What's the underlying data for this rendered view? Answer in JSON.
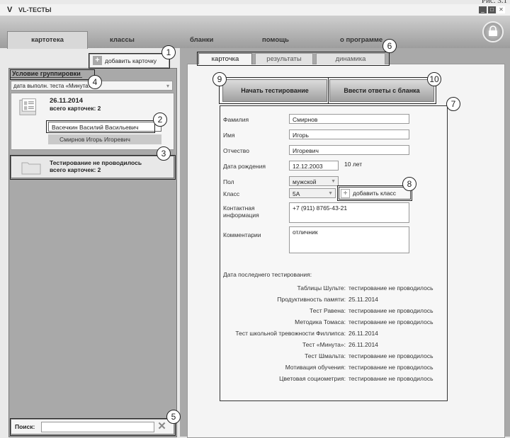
{
  "caption": "Рис. 3.1",
  "app": {
    "logo": "V",
    "title": "VL-ТЕСТЫ",
    "window_buttons": [
      "_",
      "□",
      "✕"
    ]
  },
  "tabs": [
    {
      "label": "картотека"
    },
    {
      "label": "классы"
    },
    {
      "label": "бланки"
    },
    {
      "label": "помощь"
    },
    {
      "label": "о программе"
    }
  ],
  "left": {
    "add_card_label": "добавить карточку",
    "group_label": "Условие группировки",
    "group_select_value": "дата выполн. теста «Минута»",
    "groups": [
      {
        "date": "26.11.2014",
        "count": "всего карточек: 2",
        "people": [
          "Васечкин Василий Васильевич",
          "Смирнов Игорь Игоревич"
        ]
      },
      {
        "title": "Тестирование не проводилось",
        "count": "всего карточек: 2"
      }
    ],
    "search_label": "Поиск:",
    "search_value": ""
  },
  "right": {
    "subtabs": [
      {
        "label": "карточка"
      },
      {
        "label": "результаты"
      },
      {
        "label": "динамика"
      }
    ],
    "start_test": "Начать тестирование",
    "enter_answers": "Ввести ответы с бланка",
    "form": {
      "surname_label": "Фамилия",
      "surname": "Смирнов",
      "name_label": "Имя",
      "name": "Игорь",
      "patronymic_label": "Отчество",
      "patronymic": "Игоревич",
      "dob_label": "Дата рождения",
      "dob": "12.12.2003",
      "age": "10 лет",
      "gender_label": "Пол",
      "gender": "мужской",
      "class_label": "Класс",
      "class": "5А",
      "add_class": "добавить класс",
      "contact_label": "Контактная информация",
      "contact": "+7 (911) 8765-43-21",
      "comment_label": "Комментарии",
      "comment": "отличник"
    },
    "last_test_label": "Дата последнего тестирования:",
    "results": [
      {
        "test": "Таблицы Шульте:",
        "value": "тестирование не проводилось"
      },
      {
        "test": "Продуктивность памяти:",
        "value": "25.11.2014"
      },
      {
        "test": "Тест Равена:",
        "value": "тестирование не проводилось"
      },
      {
        "test": "Методика Томаса:",
        "value": "тестирование не проводилось"
      },
      {
        "test": "Тест школьной тревожности Филлипса:",
        "value": "26.11.2014"
      },
      {
        "test": "Тест «Минута»:",
        "value": "26.11.2014"
      },
      {
        "test": "Тест Шмальта:",
        "value": "тестирование не проводилось"
      },
      {
        "test": "Мотивация обучения:",
        "value": "тестирование не проводилось"
      },
      {
        "test": "Цветовая социометрия:",
        "value": "тестирование не проводилось"
      }
    ]
  },
  "callouts": [
    "1",
    "2",
    "3",
    "4",
    "5",
    "6",
    "7",
    "8",
    "9",
    "10"
  ]
}
